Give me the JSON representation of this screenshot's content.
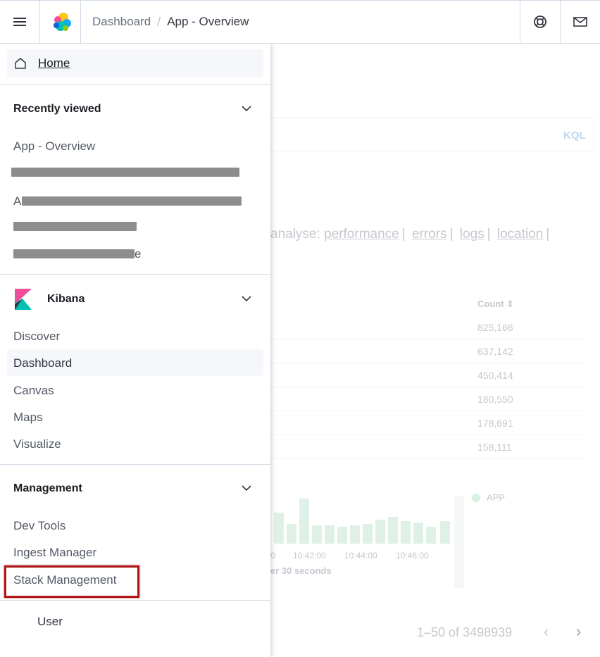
{
  "header": {
    "breadcrumbs": [
      {
        "label": "Dashboard"
      },
      {
        "label": "App - Overview"
      }
    ],
    "separator": "/",
    "icons": {
      "menu": "hamburger-menu-icon",
      "logo": "elastic-logo-icon",
      "help": "help-lifebuoy-icon",
      "news": "mail-icon"
    }
  },
  "nav": {
    "home": {
      "label": "Home",
      "icon": "home-icon"
    },
    "recently_viewed": {
      "title": "Recently viewed",
      "items": [
        {
          "label": "App - Overview"
        },
        {
          "label": "",
          "redacted": true
        },
        {
          "label": "",
          "redacted": true,
          "prefix": "A"
        },
        {
          "label": "",
          "redacted": true
        },
        {
          "label": "",
          "redacted": true,
          "suffix": "e"
        }
      ]
    },
    "kibana": {
      "title": "Kibana",
      "icon": "kibana-logo-icon",
      "items": [
        {
          "label": "Discover"
        },
        {
          "label": "Dashboard",
          "active": true
        },
        {
          "label": "Canvas"
        },
        {
          "label": "Maps"
        },
        {
          "label": "Visualize"
        }
      ]
    },
    "management": {
      "title": "Management",
      "items": [
        {
          "label": "Dev Tools"
        },
        {
          "label": "Ingest Manager"
        },
        {
          "label": "Stack Management",
          "highlighted": true
        }
      ]
    },
    "user": {
      "label": "User"
    }
  },
  "background": {
    "query_language": "KQL",
    "analyse_prefix": "analyse:",
    "analyse_links": [
      "performance",
      "errors",
      "logs",
      "location"
    ],
    "table": {
      "count_header": "Count",
      "counts": [
        "825,166",
        "637,142",
        "450,414",
        "180,550",
        "178,691",
        "158,111"
      ]
    },
    "chart": {
      "legend": "APP",
      "ticks": [
        "10:42:00",
        "10:44:00",
        "10:46:00"
      ],
      "interval_text": "er 30 seconds",
      "colors": {
        "bar": "#dff1e6",
        "legend_dot": "#d8efe2"
      }
    },
    "pagination": {
      "text": "1–50 of 3498939"
    }
  },
  "colors": {
    "highlight_box": "#b01818",
    "active_bg": "#f5f7fa",
    "kql_accent": "#b9d7f2"
  }
}
